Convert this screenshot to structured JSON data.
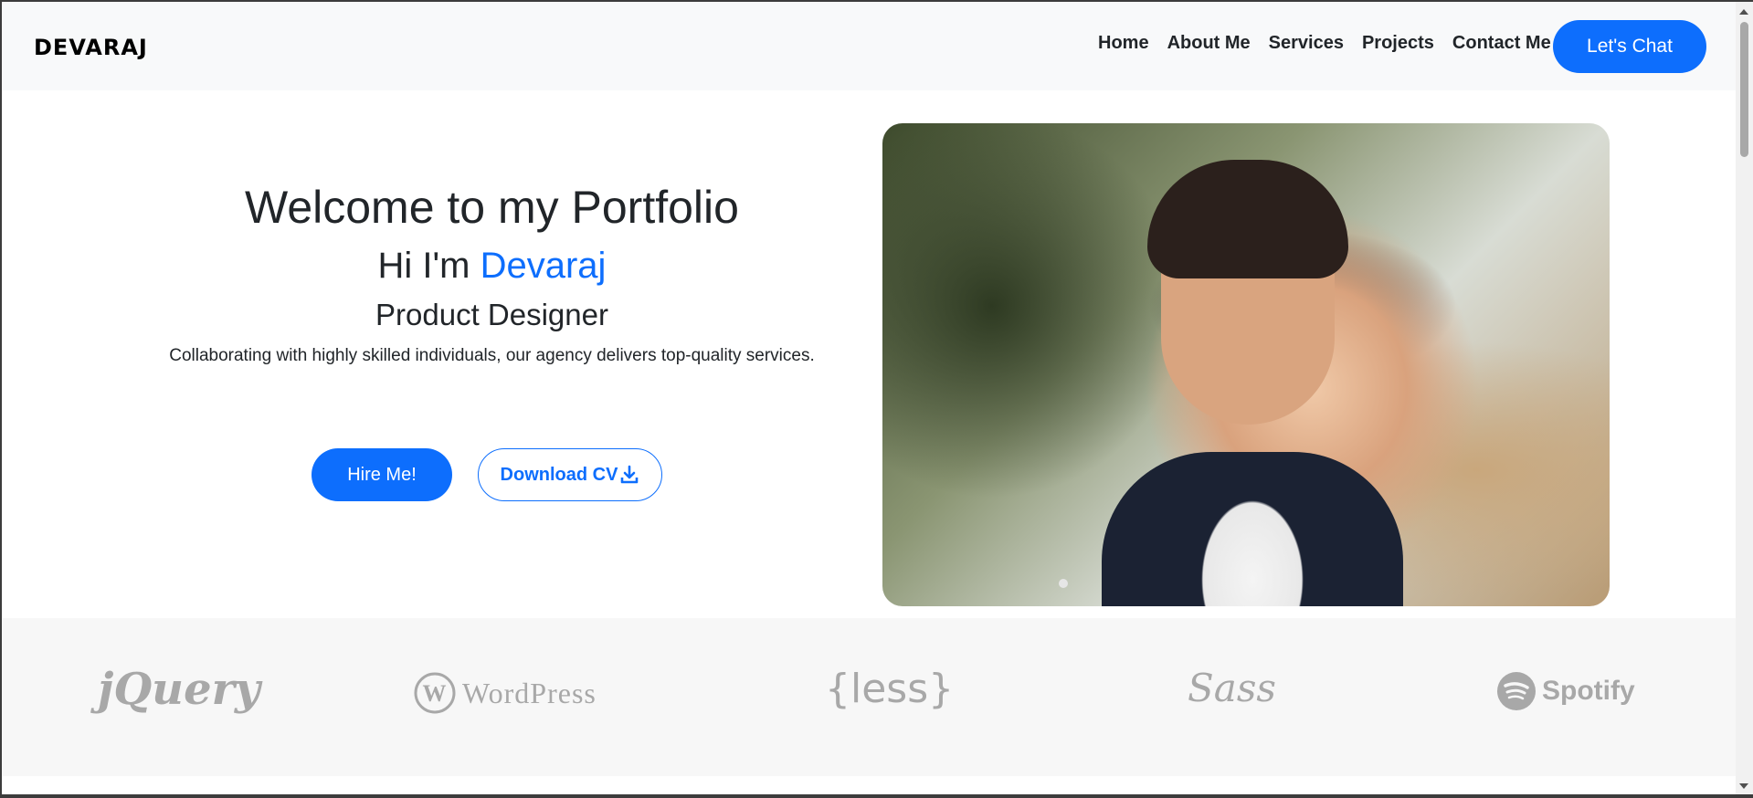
{
  "navbar": {
    "brand": "DEVARAJ",
    "links": [
      "Home",
      "About Me",
      "Services",
      "Projects",
      "Contact Me"
    ],
    "cta": "Let's Chat"
  },
  "hero": {
    "title": "Welcome to my Portfolio",
    "greeting_prefix": "Hi I'm ",
    "name": "Devaraj",
    "role": "Product Designer",
    "description": "Collaborating with highly skilled individuals, our agency delivers top-quality services.",
    "hire_button": "Hire Me!",
    "download_button": "Download CV",
    "download_icon": "download-icon"
  },
  "logos": {
    "jquery": "jQuery",
    "wordpress": "WordPress",
    "less": "{less}",
    "sass": "Sass",
    "spotify": "Spotify"
  },
  "colors": {
    "accent": "#0d6efd",
    "navbar_bg": "#f8f9fa",
    "logos_bg": "#f7f7f7",
    "logo_gray": "#a8a8a8"
  }
}
